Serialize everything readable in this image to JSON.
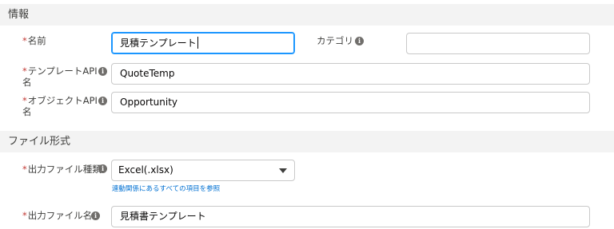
{
  "sections": {
    "info": {
      "title": "情報"
    },
    "file_format": {
      "title": "ファイル形式"
    }
  },
  "fields": {
    "name": {
      "required": "*",
      "label": "名前",
      "value": "見積テンプレート"
    },
    "category": {
      "label": "カテゴリ",
      "value": ""
    },
    "template_api": {
      "required": "*",
      "label_line1": "テンプレートAPI",
      "label_line2": "名",
      "value": "QuoteTemp"
    },
    "object_api": {
      "required": "*",
      "label_line1": "オブジェクトAPI",
      "label_line2": "名",
      "value": "Opportunity"
    },
    "output_type": {
      "required": "*",
      "label": "出力ファイル種類",
      "value": "Excel(.xlsx)",
      "helper": "連動関係にあるすべての項目を参照"
    },
    "output_name": {
      "required": "*",
      "label": "出力ファイル名",
      "value": "見積書テンプレート"
    }
  },
  "icons": {
    "info": "info-icon",
    "dropdown": "chevron-down-icon"
  },
  "colors": {
    "required": "#c23934",
    "focus": "#1b96ff",
    "link": "#0070d2",
    "section_bg": "#f3f3f3"
  }
}
